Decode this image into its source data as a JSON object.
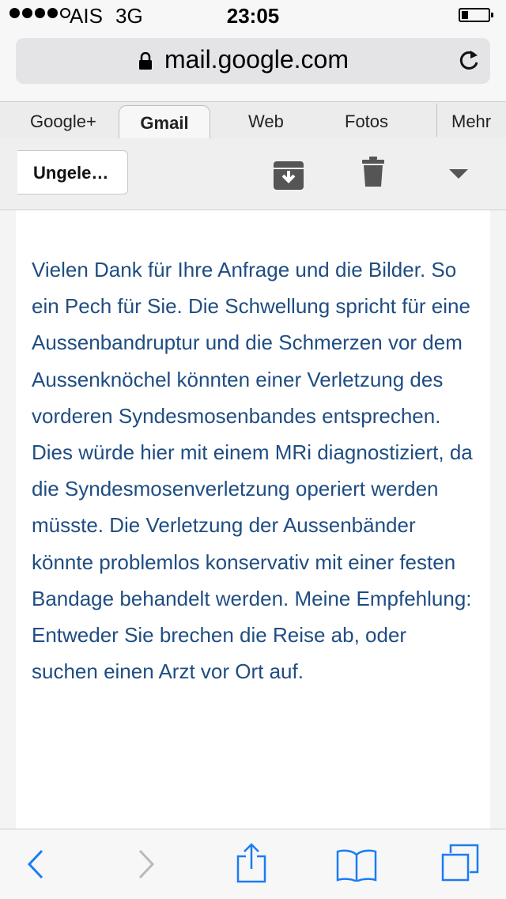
{
  "status_bar": {
    "carrier": "AIS",
    "network": "3G",
    "time": "23:05",
    "signal_bars": 4,
    "signal_max": 5,
    "battery_level": 0.2
  },
  "address_bar": {
    "url": "mail.google.com",
    "secure": true
  },
  "tabs": [
    {
      "label": "Google+"
    },
    {
      "label": "Gmail",
      "active": true
    },
    {
      "label": "Web"
    },
    {
      "label": "Fotos"
    },
    {
      "label": "Mehr"
    }
  ],
  "toolbar": {
    "back_label": "Ungele…",
    "icons": [
      "archive-icon",
      "trash-icon",
      "dropdown-caret-icon"
    ]
  },
  "message": {
    "body": "Vielen Dank für Ihre Anfrage und die Bilder. So ein Pech für Sie. Die Schwellung spricht für eine Aussenbandruptur und die Schmerzen vor dem Aussenknöchel könnten einer Verletzung des vorderen Syndesmosenbandes entsprechen. Dies würde hier mit einem MRi diagnostiziert, da die Syndesmosenverletzung operiert werden müsste. Die Verletzung der Aussenbänder könnte problemlos konservativ mit einer festen Bandage behandelt werden. Meine Empfehlung: Entweder Sie brechen die Reise ab, oder suchen einen Arzt vor Ort auf."
  },
  "bottom_bar": {
    "icons": [
      "back-icon",
      "forward-icon",
      "share-icon",
      "bookmarks-icon",
      "tabs-icon"
    ]
  },
  "colors": {
    "link_blue": "#1a7cf5",
    "message_text": "#1f4d82",
    "disabled": "#b9b9b9"
  }
}
